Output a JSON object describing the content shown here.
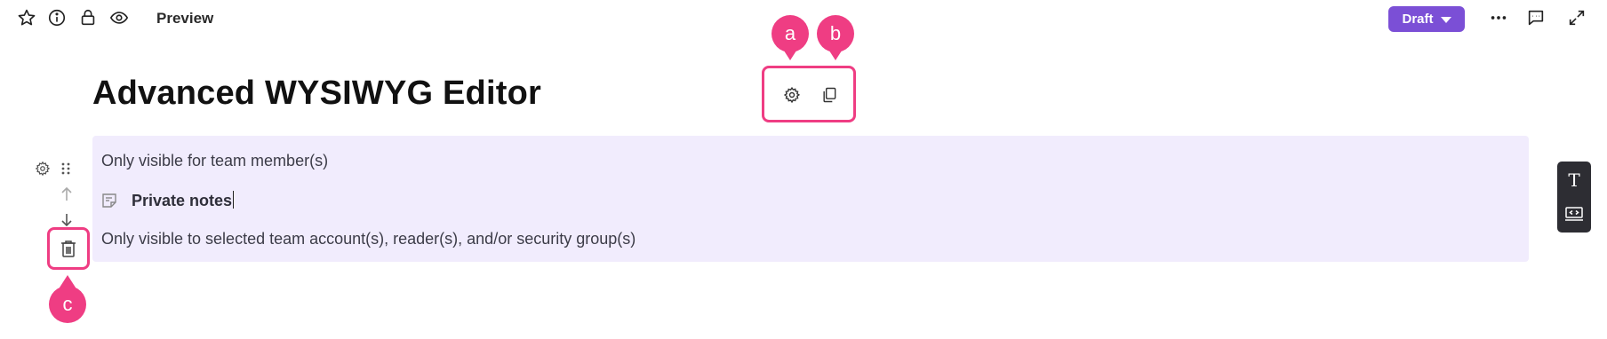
{
  "toolbar": {
    "preview_label": "Preview",
    "draft_label": "Draft",
    "icons": [
      "star-icon",
      "info-icon",
      "lock-icon",
      "eye-icon",
      "more-icon",
      "comment-icon",
      "expand-icon"
    ]
  },
  "page": {
    "title": "Advanced WYSIWYG Editor"
  },
  "block": {
    "visibility_text": "Only visible for team member(s)",
    "private_notes": "Private notes",
    "selected_text": "Only visible to selected team account(s), reader(s), and/or security group(s)"
  },
  "annotations": {
    "a": "a",
    "b": "b",
    "c": "c"
  },
  "right_panel": {
    "text_tool": "T"
  },
  "colors": {
    "accent": "#7b4fd6",
    "highlight": "#ef3d83",
    "block_bg": "#f1ecfd",
    "panel_bg": "#2d2d33"
  }
}
